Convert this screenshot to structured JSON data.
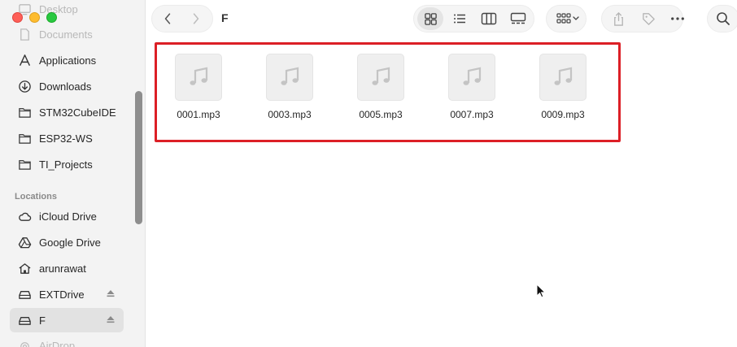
{
  "window": {
    "title": "F"
  },
  "sidebar": {
    "favorites": [
      {
        "label": "Desktop",
        "icon": "desktop-icon",
        "faded": true
      },
      {
        "label": "Documents",
        "icon": "document-icon",
        "faded": true
      },
      {
        "label": "Applications",
        "icon": "applications-icon"
      },
      {
        "label": "Downloads",
        "icon": "downloads-icon"
      },
      {
        "label": "STM32CubeIDE",
        "icon": "folder-icon"
      },
      {
        "label": "ESP32-WS",
        "icon": "folder-icon"
      },
      {
        "label": "TI_Projects",
        "icon": "folder-icon"
      }
    ],
    "locations_header": "Locations",
    "locations": [
      {
        "label": "iCloud Drive",
        "icon": "cloud-icon"
      },
      {
        "label": "Google Drive",
        "icon": "google-drive-icon"
      },
      {
        "label": "arunrawat",
        "icon": "home-icon"
      },
      {
        "label": "EXTDrive",
        "icon": "drive-icon",
        "eject": true
      },
      {
        "label": "F",
        "icon": "drive-icon",
        "eject": true,
        "selected": true
      },
      {
        "label": "AirDrop",
        "icon": "airdrop-icon",
        "faded": true
      }
    ]
  },
  "toolbar": {
    "back": "chevron-left-icon",
    "forward": "chevron-right-icon",
    "views": [
      "icon-view-icon",
      "list-view-icon",
      "column-view-icon",
      "gallery-view-icon"
    ],
    "group": "group-by-icon",
    "share": "share-icon",
    "tag": "tag-icon",
    "more": "more-icon",
    "search": "search-icon"
  },
  "files": [
    {
      "name": "0001.mp3",
      "icon": "music-note-icon"
    },
    {
      "name": "0003.mp3",
      "icon": "music-note-icon"
    },
    {
      "name": "0005.mp3",
      "icon": "music-note-icon"
    },
    {
      "name": "0007.mp3",
      "icon": "music-note-icon"
    },
    {
      "name": "0009.mp3",
      "icon": "music-note-icon"
    }
  ],
  "colors": {
    "highlight_border": "#dc1f26",
    "selected_bg": "#e2e2e2",
    "sidebar_bg": "#f3f3f3"
  }
}
